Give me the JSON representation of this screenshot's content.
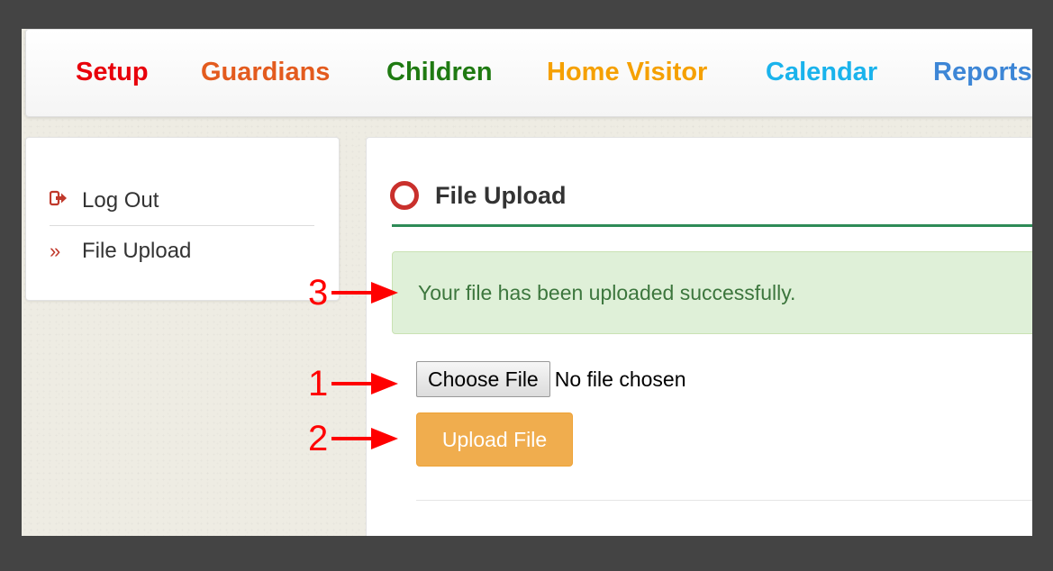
{
  "nav": {
    "items": [
      {
        "label": "Setup",
        "color": "#e8000b"
      },
      {
        "label": "Guardians",
        "color": "#e35b1e"
      },
      {
        "label": "Children",
        "color": "#1f7a12"
      },
      {
        "label": "Home Visitor",
        "color": "#f5a000"
      },
      {
        "label": "Calendar",
        "color": "#1ab3ec"
      },
      {
        "label": "Reports",
        "color": "#3d86d6"
      }
    ]
  },
  "sidebar": {
    "items": [
      {
        "label": "Log Out",
        "icon": "sign-out-icon"
      },
      {
        "label": "File Upload",
        "icon": "double-chevron-right-icon"
      }
    ]
  },
  "main": {
    "title": "File Upload",
    "title_icon": "circle-outline-icon",
    "alert_text": "Your file has been uploaded successfully.",
    "choose_file_label": "Choose File",
    "no_file_text": "No file chosen",
    "upload_button_label": "Upload File"
  },
  "annotations": [
    {
      "number": "1"
    },
    {
      "number": "2"
    },
    {
      "number": "3"
    }
  ],
  "colors": {
    "title_rule": "#2e8b57",
    "alert_bg": "#dff0d8",
    "alert_text": "#3c763d",
    "upload_button": "#f0ad4e",
    "annotation": "#ff0000"
  }
}
